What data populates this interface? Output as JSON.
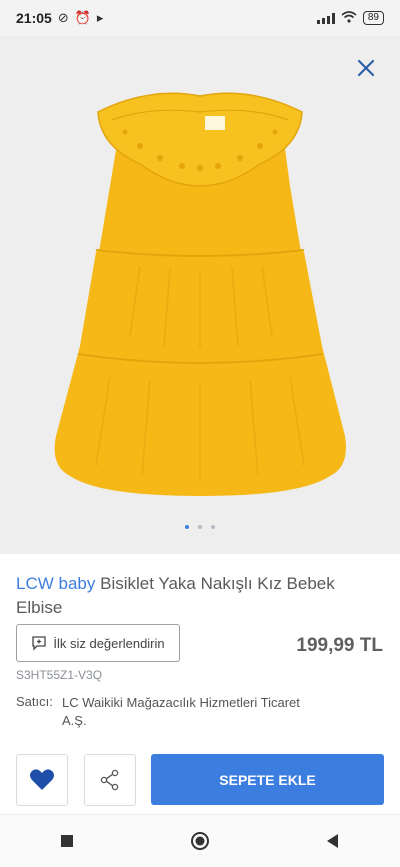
{
  "status_bar": {
    "time": "21:05",
    "battery": "89"
  },
  "product": {
    "brand": "LCW baby",
    "name": "Bisiklet Yaka Nakışlı Kız Bebek Elbise",
    "review_button": "İlk siz değerlendirin",
    "price": "199,99 TL",
    "sku": "S3HT55Z1-V3Q",
    "seller_label": "Satıcı:",
    "seller_name": "LC Waikiki Mağazacılık Hizmetleri Ticaret A.Ş."
  },
  "gallery": {
    "image_count": 3,
    "active_index": 0
  },
  "actions": {
    "add_to_cart": "SEPETE EKLE"
  },
  "colors": {
    "accent": "#3c7ee0",
    "dress": "#f5b817",
    "heart": "#1f4fa8"
  },
  "icons": [
    "close-icon",
    "heart-icon",
    "share-icon",
    "add-review-icon",
    "home-icon",
    "back-icon",
    "recent-apps-icon"
  ]
}
